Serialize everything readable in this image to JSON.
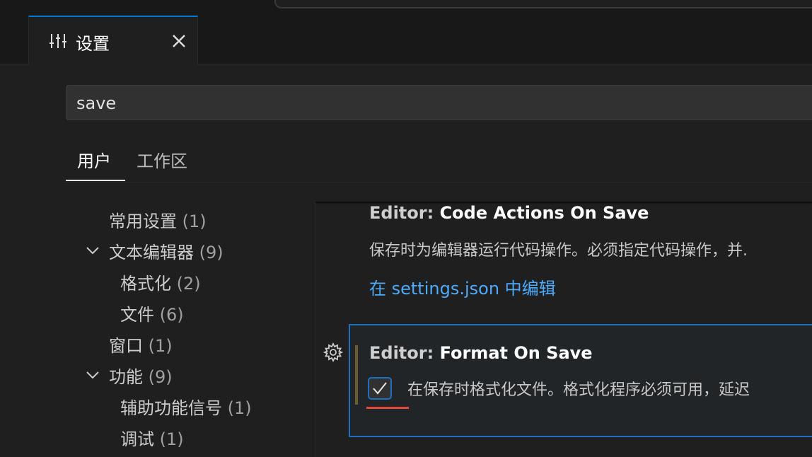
{
  "tab": {
    "title": "设置",
    "icon": "settings-sliders-icon",
    "close_icon": "close-icon"
  },
  "search": {
    "value": "save"
  },
  "scopes": {
    "user": "用户",
    "workspace": "工作区"
  },
  "toc": [
    {
      "label": "常用设置",
      "count": "(1)",
      "expandable": false
    },
    {
      "label": "文本编辑器",
      "count": "(9)",
      "expandable": true
    },
    {
      "label": "格式化",
      "count": "(2)",
      "expandable": false
    },
    {
      "label": "文件",
      "count": "(6)",
      "expandable": false
    },
    {
      "label": "窗口",
      "count": "(1)",
      "expandable": false
    },
    {
      "label": "功能",
      "count": "(9)",
      "expandable": true
    },
    {
      "label": "辅助功能信号",
      "count": "(1)",
      "expandable": false
    },
    {
      "label": "调试",
      "count": "(1)",
      "expandable": false
    }
  ],
  "settings": [
    {
      "category": "Editor: ",
      "name": "Code Actions On Save",
      "description": "保存时为编辑器运行代码操作。必须指定代码操作，并.",
      "link": "在 settings.json 中编辑"
    },
    {
      "category": "Editor: ",
      "name": "Format On Save",
      "description": "在保存时格式化文件。格式化程序必须可用，延迟",
      "checked": true
    }
  ],
  "colors": {
    "accent": "#0078d4",
    "focus_border": "#1f6fbf",
    "link": "#4daafc",
    "annotation": "#e04a3a"
  }
}
